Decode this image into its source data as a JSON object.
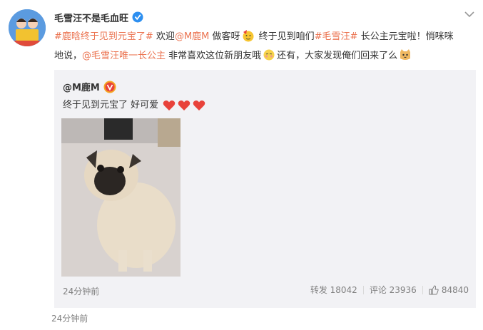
{
  "post": {
    "author": "毛雪汪不是毛血旺",
    "verified_icon": "blue-verified-badge-icon",
    "more_icon": "chevron-down-icon",
    "avatar_label": "毛雪汪",
    "text": {
      "topic1": "#鹿晗终于见到元宝了#",
      "seg1": " 欢迎",
      "mention1": "@M鹿M",
      "seg2": " 做客呀",
      "seg3": " 终于见到咱们",
      "topic2": "#毛雪汪#",
      "seg4": " 长公主元宝啦！悄咪咪地说，",
      "mention2": "@毛雪汪唯一长公主",
      "seg5": " 非常喜欢这位新朋友哦",
      "seg6": "还有，大家发现俺们回来了么"
    },
    "time": "24分钟前"
  },
  "repost": {
    "author": "@M鹿M",
    "badge_icon": "gold-verified-badge-icon",
    "text": "终于见到元宝了 好可爱",
    "hearts": [
      "heart-icon",
      "heart-icon",
      "heart-icon"
    ],
    "time": "24分钟前",
    "forward_label": "转发 18042",
    "comment_label": "评论 23936",
    "like_count": "84840"
  },
  "colors": {
    "link": "#eb7350",
    "muted": "#808080",
    "repost_bg": "#f2f2f5",
    "heart": "#e8423a"
  }
}
